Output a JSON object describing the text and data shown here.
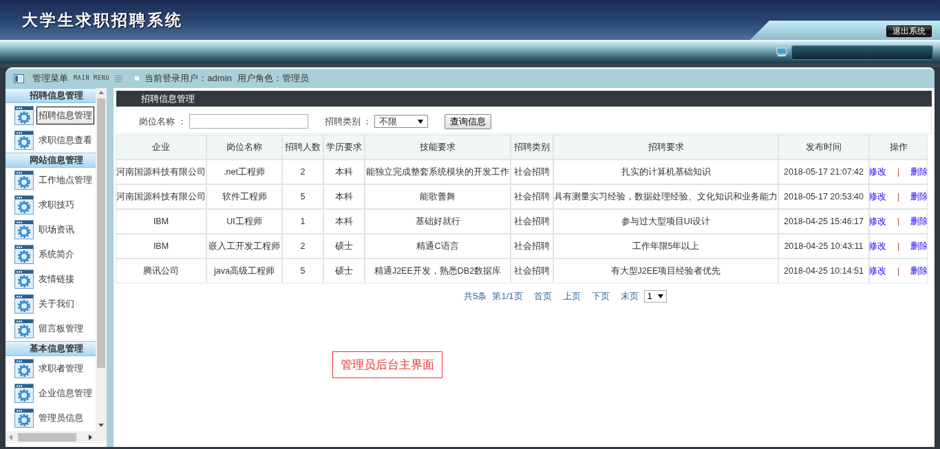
{
  "header": {
    "title": "大学生求职招聘系统",
    "logout_button": "退出系统"
  },
  "sidebar": {
    "title": "管理菜单",
    "subtitle": "MAIN MENU",
    "groups": [
      {
        "title": "招聘信息管理",
        "items": [
          {
            "label": "招聘信息管理",
            "selected": true
          },
          {
            "label": "求职信息查看",
            "selected": false
          }
        ]
      },
      {
        "title": "网站信息管理",
        "items": [
          {
            "label": "工作地点管理",
            "selected": false
          },
          {
            "label": "求职技巧",
            "selected": false
          },
          {
            "label": "职场资讯",
            "selected": false
          },
          {
            "label": "系统简介",
            "selected": false
          },
          {
            "label": "友情链接",
            "selected": false
          },
          {
            "label": "关于我们",
            "selected": false
          },
          {
            "label": "留言板管理",
            "selected": false
          }
        ]
      },
      {
        "title": "基本信息管理",
        "items": [
          {
            "label": "求职者管理",
            "selected": false
          },
          {
            "label": "企业信息管理",
            "selected": false
          },
          {
            "label": "管理员信息",
            "selected": false
          }
        ]
      }
    ]
  },
  "user_bar": {
    "user": "当前登录用户：admin",
    "role": "用户角色：管理员"
  },
  "content": {
    "title": "招聘信息管理",
    "search": {
      "fields": [
        {
          "label": "岗位名称 ：",
          "kind": "text"
        },
        {
          "label": "招聘类别 ：",
          "kind": "select",
          "value": "不限"
        }
      ],
      "button": "查询信息"
    },
    "table": {
      "columns": [
        "企业",
        "岗位名称",
        "招聘人数",
        "学历要求",
        "技能要求",
        "招聘类别",
        "招聘要求",
        "发布时间",
        "操作"
      ],
      "rows": [
        {
          "cells": [
            "河南国源科技有限公司",
            ".net工程师",
            "2",
            "本科",
            "能独立完成整套系统模块的开发工作",
            "社会招聘",
            "扎实的计算机基础知识",
            "2018-05-17 21:07:42"
          ],
          "actions": [
            "修改",
            "|",
            "删除"
          ]
        },
        {
          "cells": [
            "河南国源科技有限公司",
            "软件工程师",
            "5",
            "本科",
            "能歌善舞",
            "社会招聘",
            "具有测量实习经验，数据处理经验、文化知识和业务能力",
            "2018-05-17 20:53:40"
          ],
          "actions": [
            "修改",
            "|",
            "删除"
          ]
        },
        {
          "cells": [
            "IBM",
            "UI工程师",
            "1",
            "本科",
            "基础好就行",
            "社会招聘",
            "参与过大型项目UI设计",
            "2018-04-25 15:46:17"
          ],
          "actions": [
            "修改",
            "|",
            "删除"
          ]
        },
        {
          "cells": [
            "IBM",
            "嵌入工开发工程师",
            "2",
            "硕士",
            "精通C语言",
            "社会招聘",
            "工作年限5年以上",
            "2018-04-25 10:43:11"
          ],
          "actions": [
            "修改",
            "|",
            "删除"
          ]
        },
        {
          "cells": [
            "腾讯公司",
            "java高级工程师",
            "5",
            "硕士",
            "精通J2EE开发，熟悉DB2数据库",
            "社会招聘",
            "有大型J2EE项目经验者优先",
            "2018-04-25 10:14:51"
          ],
          "actions": [
            "修改",
            "|",
            "删除"
          ]
        }
      ]
    },
    "pagination": {
      "summary": [
        "共5条",
        "第1/1页"
      ],
      "links": [
        "首页",
        "上页",
        "下页",
        "末页"
      ],
      "page_select": "1"
    },
    "annotation": "管理员后台主界面"
  }
}
